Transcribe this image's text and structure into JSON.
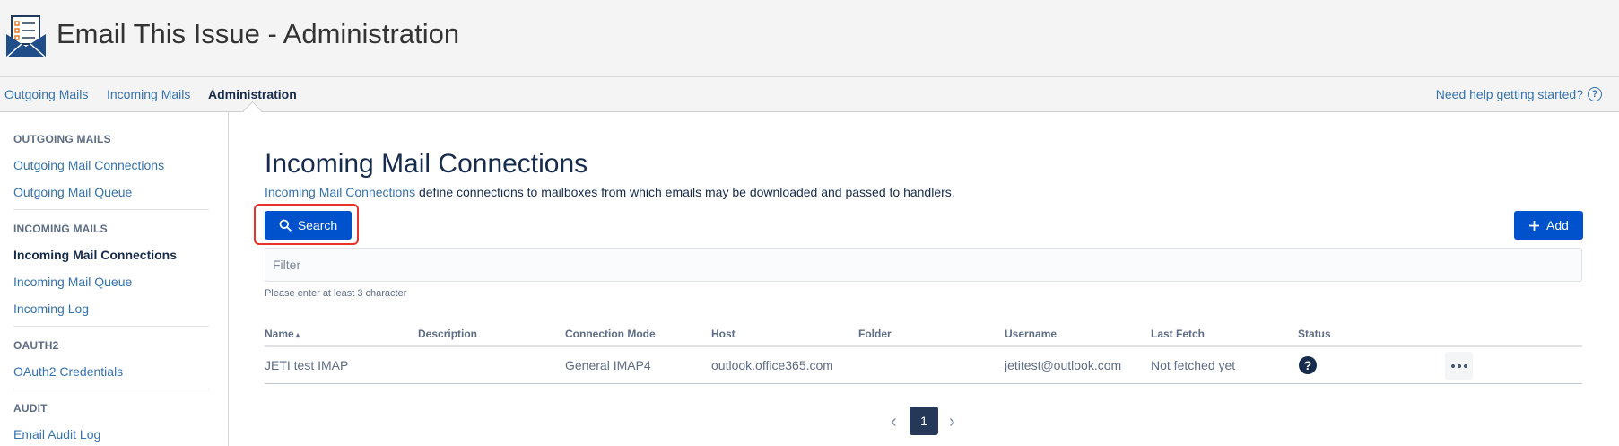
{
  "header": {
    "title": "Email This Issue - Administration"
  },
  "nav": {
    "items": [
      {
        "label": "Outgoing Mails"
      },
      {
        "label": "Incoming Mails"
      },
      {
        "label": "Administration"
      }
    ],
    "help": {
      "label": "Need help getting started?",
      "icon": "question-circle-icon"
    }
  },
  "sidebar": {
    "sections": [
      {
        "heading": "OUTGOING MAILS",
        "items": [
          "Outgoing Mail Connections",
          "Outgoing Mail Queue"
        ]
      },
      {
        "heading": "INCOMING MAILS",
        "items": [
          "Incoming Mail Connections",
          "Incoming Mail Queue",
          "Incoming Log"
        ]
      },
      {
        "heading": "OAUTH2",
        "items": [
          "OAuth2 Credentials"
        ]
      },
      {
        "heading": "AUDIT",
        "items": [
          "Email Audit Log"
        ]
      }
    ]
  },
  "main": {
    "title": "Incoming Mail Connections",
    "description": {
      "link": "Incoming Mail Connections",
      "text": " define connections to mailboxes from which emails may be downloaded and passed to handlers."
    },
    "search_button": "Search",
    "add_button": "Add",
    "filter": {
      "placeholder": "Filter",
      "hint": "Please enter at least 3 character"
    },
    "table": {
      "columns": [
        "Name",
        "Description",
        "Connection Mode",
        "Host",
        "Folder",
        "Username",
        "Last Fetch",
        "Status"
      ],
      "sort_indicator": "▴",
      "rows": [
        {
          "name": "JETI test IMAP",
          "description": "",
          "connection_mode": "General IMAP4",
          "host": "outlook.office365.com",
          "folder": "",
          "username": "jetitest@outlook.com",
          "last_fetch": "Not fetched yet",
          "status_icon": "question-icon"
        }
      ]
    },
    "pagination": {
      "current": "1",
      "prev": "‹",
      "next": "›"
    }
  },
  "colors": {
    "primary": "#0052cc",
    "link": "#3572b0",
    "highlight": "#e8322c",
    "page_active": "#253858"
  }
}
